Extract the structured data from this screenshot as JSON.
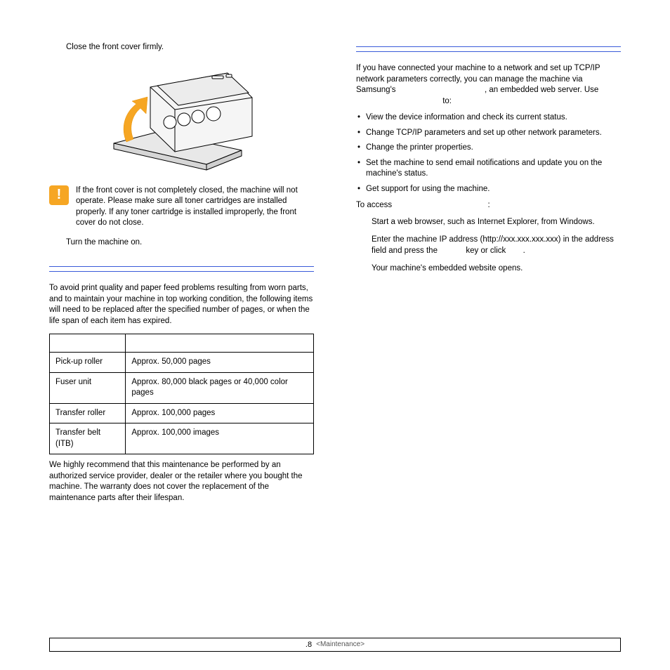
{
  "left": {
    "step_close": "Close the front cover firmly.",
    "caution": "If the front cover is not completely closed, the machine will not operate. Please make sure all toner cartridges are installed properly. If any toner cartridge is installed improperly, the front cover do not close.",
    "step_turnon": "Turn the machine on.",
    "maint_intro": "To avoid print quality and paper feed problems resulting from worn parts, and to maintain your machine in top working condition, the following items will need to be replaced after the specified number of pages, or when the life span of each item has expired.",
    "table": {
      "rows": [
        {
          "item": "Pick-up roller",
          "yield": "Approx. 50,000 pages"
        },
        {
          "item": "Fuser unit",
          "yield": "Approx. 80,000 black pages or 40,000 color pages"
        },
        {
          "item": "Transfer roller",
          "yield": "Approx. 100,000 pages"
        },
        {
          "item": "Transfer belt (ITB)",
          "yield": "Approx. 100,000 images"
        }
      ]
    },
    "maint_note": "We highly recommend that this maintenance be performed by an authorized service provider, dealer or the retailer where you bought the machine. The warranty does not cover the replacement of the maintenance parts after their lifespan."
  },
  "right": {
    "intro_a": "If you have connected your machine to a network and set up TCP/IP network parameters correctly, you can manage the machine via Samsung's ",
    "intro_b": ", an embedded web server. Use ",
    "intro_c": " to:",
    "bullets": [
      "View the device information and check its current status.",
      "Change TCP/IP parameters and set up other network parameters.",
      "Change the printer properties.",
      "Set the machine to send email notifications and update you on the machine's status.",
      "Get support for using the machine."
    ],
    "access_label": "To access ",
    "access_colon": ":",
    "step1": "Start a web browser, such as Internet Explorer, from Windows.",
    "step2_a": "Enter the machine IP address (http://xxx.xxx.xxx.xxx) in the address field and press the ",
    "step2_b": " key or click ",
    "step2_c": ".",
    "step3": "Your machine's embedded website opens."
  },
  "footer": {
    "page": ".8",
    "section": "<Maintenance>"
  }
}
